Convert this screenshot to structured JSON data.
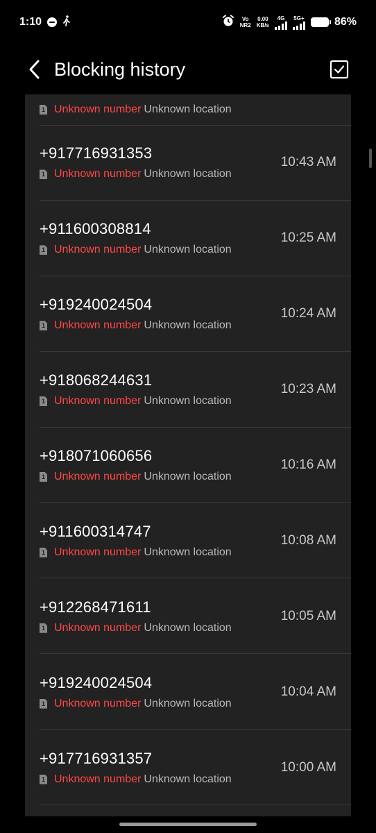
{
  "status_bar": {
    "time": "1:10",
    "volte_top": "Vo",
    "volte_bottom": "NR2",
    "speed_top": "0.00",
    "speed_bottom": "KB/s",
    "net1": "4G",
    "net2": "5G+",
    "battery": "86%",
    "icons": [
      "message-bubble-icon",
      "walking-icon",
      "alarm-icon",
      "signal-icon",
      "battery-icon"
    ]
  },
  "header": {
    "title": "Blocking history",
    "back_icon": "chevron-left-icon",
    "select_icon": "checkbox-icon"
  },
  "partial_row": {
    "sim": "1",
    "unknown_number": "Unknown number",
    "unknown_location": "Unknown location"
  },
  "calls": [
    {
      "number": "+917716931353",
      "sim": "1",
      "unknown_number": "Unknown number",
      "unknown_location": "Unknown location",
      "time": "10:43 AM"
    },
    {
      "number": "+911600308814",
      "sim": "1",
      "unknown_number": "Unknown number",
      "unknown_location": "Unknown location",
      "time": "10:25 AM"
    },
    {
      "number": "+919240024504",
      "sim": "1",
      "unknown_number": "Unknown number",
      "unknown_location": "Unknown location",
      "time": "10:24 AM"
    },
    {
      "number": "+918068244631",
      "sim": "1",
      "unknown_number": "Unknown number",
      "unknown_location": "Unknown location",
      "time": "10:23 AM"
    },
    {
      "number": "+918071060656",
      "sim": "1",
      "unknown_number": "Unknown number",
      "unknown_location": "Unknown location",
      "time": "10:16 AM"
    },
    {
      "number": "+911600314747",
      "sim": "1",
      "unknown_number": "Unknown number",
      "unknown_location": "Unknown location",
      "time": "10:08 AM"
    },
    {
      "number": "+912268471611",
      "sim": "1",
      "unknown_number": "Unknown number",
      "unknown_location": "Unknown location",
      "time": "10:05 AM"
    },
    {
      "number": "+919240024504",
      "sim": "1",
      "unknown_number": "Unknown number",
      "unknown_location": "Unknown location",
      "time": "10:04 AM"
    },
    {
      "number": "+917716931357",
      "sim": "1",
      "unknown_number": "Unknown number",
      "unknown_location": "Unknown location",
      "time": "10:00 AM"
    }
  ],
  "colors": {
    "accent_red": "#ff4747",
    "list_background": "#222222",
    "screen_background": "#000000"
  }
}
